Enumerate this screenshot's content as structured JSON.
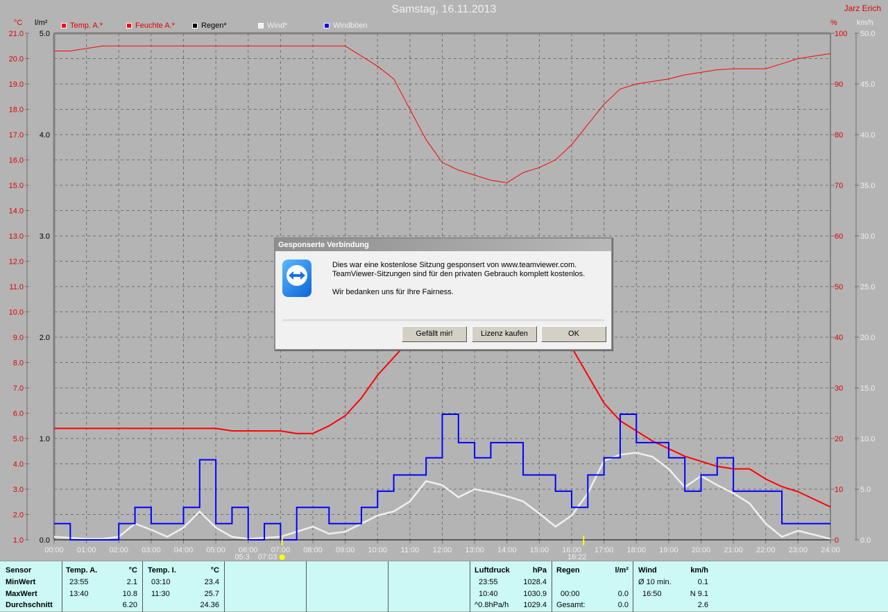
{
  "header": {
    "title": "Samstag, 16.11.2013",
    "author": "Jarz Erich"
  },
  "units": {
    "temp": "°C",
    "rain": "l/m²",
    "humidity": "%",
    "wind": "km/h"
  },
  "legend": [
    {
      "label": "Temp. A.*",
      "color": "#ff0000",
      "text_color": "#e00000"
    },
    {
      "label": "Feuchte A.*",
      "color": "#ff0000",
      "text_color": "#e00000"
    },
    {
      "label": "Regen*",
      "color": "#000000",
      "text_color": "#000000"
    },
    {
      "label": "Wind*",
      "color": "#f0f0f0",
      "text_color": "#f0f0f0"
    },
    {
      "label": "Windböen",
      "color": "#0000ff",
      "text_color": "#f0f0f0"
    }
  ],
  "chart_data": {
    "type": "line",
    "x_ticks": [
      "00:00",
      "01:00",
      "02:00",
      "03:00",
      "04:00",
      "05:00",
      "06:00",
      "07:00",
      "08:00",
      "09:00",
      "10:00",
      "11:00",
      "12:00",
      "13:00",
      "14:00",
      "15:00",
      "16:00",
      "17:00",
      "18:00",
      "19:00",
      "20:00",
      "21:00",
      "22:00",
      "23:00",
      "24:00"
    ],
    "temp_ticks": [
      "21.0",
      "20.0",
      "19.0",
      "18.0",
      "17.0",
      "16.0",
      "15.0",
      "14.0",
      "13.0",
      "12.0",
      "11.0",
      "10.0",
      "9.0",
      "8.0",
      "7.0",
      "6.0",
      "5.0",
      "4.0",
      "3.0",
      "2.0",
      "1.0"
    ],
    "rain_ticks": [
      "5.0",
      "4.0",
      "3.0",
      "2.0",
      "1.0",
      "0.0"
    ],
    "humidity_ticks": [
      "100",
      "90",
      "80",
      "70",
      "60",
      "50",
      "40",
      "30",
      "20",
      "10",
      "0"
    ],
    "wind_ticks": [
      "50.0",
      "45.0",
      "40.0",
      "35.0",
      "30.0",
      "25.0",
      "20.0",
      "15.0",
      "10.0",
      "5.0",
      "0.0"
    ],
    "ylim_temp": [
      1,
      21
    ],
    "ylim_rain": [
      0,
      5
    ],
    "ylim_humidity": [
      0,
      100
    ],
    "ylim_wind": [
      0,
      50
    ],
    "x_hours": [
      0,
      0.5,
      1,
      1.5,
      2,
      2.5,
      3,
      3.5,
      4,
      4.5,
      5,
      5.5,
      6,
      6.5,
      7,
      7.5,
      8,
      8.5,
      9,
      9.5,
      10,
      10.5,
      11,
      11.5,
      12,
      12.5,
      13,
      13.5,
      14,
      14.5,
      15,
      15.5,
      16,
      16.5,
      17,
      17.5,
      18,
      18.5,
      19,
      19.5,
      20,
      20.5,
      21,
      21.5,
      22,
      22.5,
      23,
      23.5,
      24
    ],
    "series": [
      {
        "name": "Temp. A.",
        "axis": "temp",
        "color": "#ff0000",
        "width": 2,
        "values": [
          5.4,
          5.4,
          5.4,
          5.4,
          5.4,
          5.4,
          5.4,
          5.4,
          5.4,
          5.4,
          5.4,
          5.3,
          5.3,
          5.3,
          5.3,
          5.2,
          5.2,
          5.5,
          5.9,
          6.6,
          7.5,
          8.2,
          8.9,
          9.8,
          10.4,
          10.7,
          10.8,
          10.8,
          10.7,
          10.5,
          10.2,
          9.5,
          8.6,
          7.5,
          6.4,
          5.7,
          5.3,
          4.9,
          4.6,
          4.3,
          4.1,
          3.9,
          3.8,
          3.8,
          3.4,
          3.1,
          2.9,
          2.6,
          2.3
        ]
      },
      {
        "name": "Feuchte A.",
        "axis": "humidity",
        "color": "#ff0000",
        "width": 1,
        "values": [
          96.5,
          96.5,
          97,
          97.5,
          97.5,
          97.5,
          97.5,
          97.5,
          97.5,
          97.5,
          97.5,
          97.5,
          97.5,
          97.5,
          97.5,
          97.5,
          97.5,
          97.5,
          97.5,
          95.5,
          93.5,
          91,
          85,
          79,
          74.5,
          73,
          72,
          71,
          70.5,
          72.5,
          73.5,
          75,
          78,
          82,
          86,
          89,
          90,
          90.5,
          91,
          91.8,
          92.3,
          92.8,
          93,
          93,
          93,
          94,
          95,
          95.5,
          96
        ]
      },
      {
        "name": "Regen",
        "axis": "rain",
        "color": "#000000",
        "width": 1,
        "values": [
          0,
          0,
          0,
          0,
          0,
          0,
          0,
          0,
          0,
          0,
          0,
          0,
          0,
          0,
          0,
          0,
          0,
          0,
          0,
          0,
          0,
          0,
          0,
          0,
          0,
          0,
          0,
          0,
          0,
          0,
          0,
          0,
          0,
          0,
          0,
          0,
          0,
          0,
          0,
          0,
          0,
          0,
          0,
          0,
          0,
          0,
          0,
          0,
          0
        ]
      },
      {
        "name": "Wind",
        "axis": "wind",
        "color": "#f0f0f0",
        "width": 2.5,
        "values": [
          0.3,
          0.2,
          0.1,
          0.1,
          0.3,
          1.6,
          1.0,
          0.3,
          1.2,
          2.8,
          1.2,
          0.3,
          0.1,
          0.2,
          0.3,
          0.8,
          1.3,
          0.6,
          0.8,
          1.6,
          2.4,
          2.8,
          3.8,
          5.8,
          5.4,
          4.2,
          5.0,
          4.7,
          4.3,
          3.8,
          2.6,
          1.3,
          2.4,
          4.6,
          7.8,
          8.4,
          8.6,
          8.2,
          7.0,
          5.2,
          6.3,
          5.4,
          4.6,
          3.6,
          1.6,
          0.3,
          0.9,
          0.5,
          0.1
        ]
      },
      {
        "name": "Windböen",
        "axis": "wind",
        "color": "#0000ff",
        "width": 2,
        "values": [
          1.6,
          0,
          0,
          0,
          1.6,
          3.2,
          1.6,
          1.6,
          3.2,
          7.9,
          1.6,
          3.2,
          0,
          1.6,
          0,
          3.2,
          3.2,
          1.6,
          1.6,
          3.2,
          4.8,
          6.4,
          6.4,
          8.1,
          12.4,
          9.6,
          8.1,
          9.6,
          9.6,
          6.4,
          6.4,
          4.8,
          3.2,
          6.4,
          8.1,
          12.4,
          9.6,
          9.6,
          8.1,
          4.8,
          6.4,
          8.1,
          4.8,
          4.8,
          4.8,
          1.6,
          1.6,
          1.6,
          1.6
        ]
      }
    ]
  },
  "sun": {
    "rise_1": "05:3",
    "rise_2": "07:03",
    "set": "16:22"
  },
  "table": {
    "rows": [
      "Sensor",
      "MinWert",
      "MaxWert",
      "Durchschnitt"
    ],
    "temp_a": {
      "title": "Temp. A.",
      "unit": "°C",
      "min_time": "23:55",
      "min": "2.1",
      "max_time": "13:40",
      "max": "10.8",
      "avg": "6.20"
    },
    "temp_i": {
      "title": "Temp. I.",
      "unit": "°C",
      "min_time": "03:10",
      "min": "23.4",
      "max_time": "11:30",
      "max": "25.7",
      "avg": "24.36"
    },
    "pressure": {
      "title": "Luftdruck",
      "unit": "hPa",
      "min_time": "23:55",
      "min": "1028.4",
      "max_time": "10:40",
      "max": "1030.9",
      "trend": "^0.8hPa/h",
      "avg": "1029.4"
    },
    "rain": {
      "title": "Regen",
      "unit": "l/m²",
      "max_time": "00:00",
      "max": "0.0",
      "total_label": "Gesamt:",
      "total": "0.0"
    },
    "wind": {
      "title": "Wind",
      "unit": "km/h",
      "avg_label": "Ø 10 min.",
      "avg_val": "0.1",
      "max_time": "16:50",
      "max": "N 9.1",
      "mean": "2.6"
    }
  },
  "dialog": {
    "title": "Gesponserte Verbindung",
    "line1": "Dies war eine kostenlose Sitzung gesponsert von www.teamviewer.com.",
    "line2": "TeamViewer-Sitzungen sind für den privaten Gebrauch komplett kostenlos.",
    "line3": "Wir bedanken uns für Ihre Fairness.",
    "buttons": [
      "Gefällt mir!",
      "Lizenz kaufen",
      "OK"
    ]
  }
}
